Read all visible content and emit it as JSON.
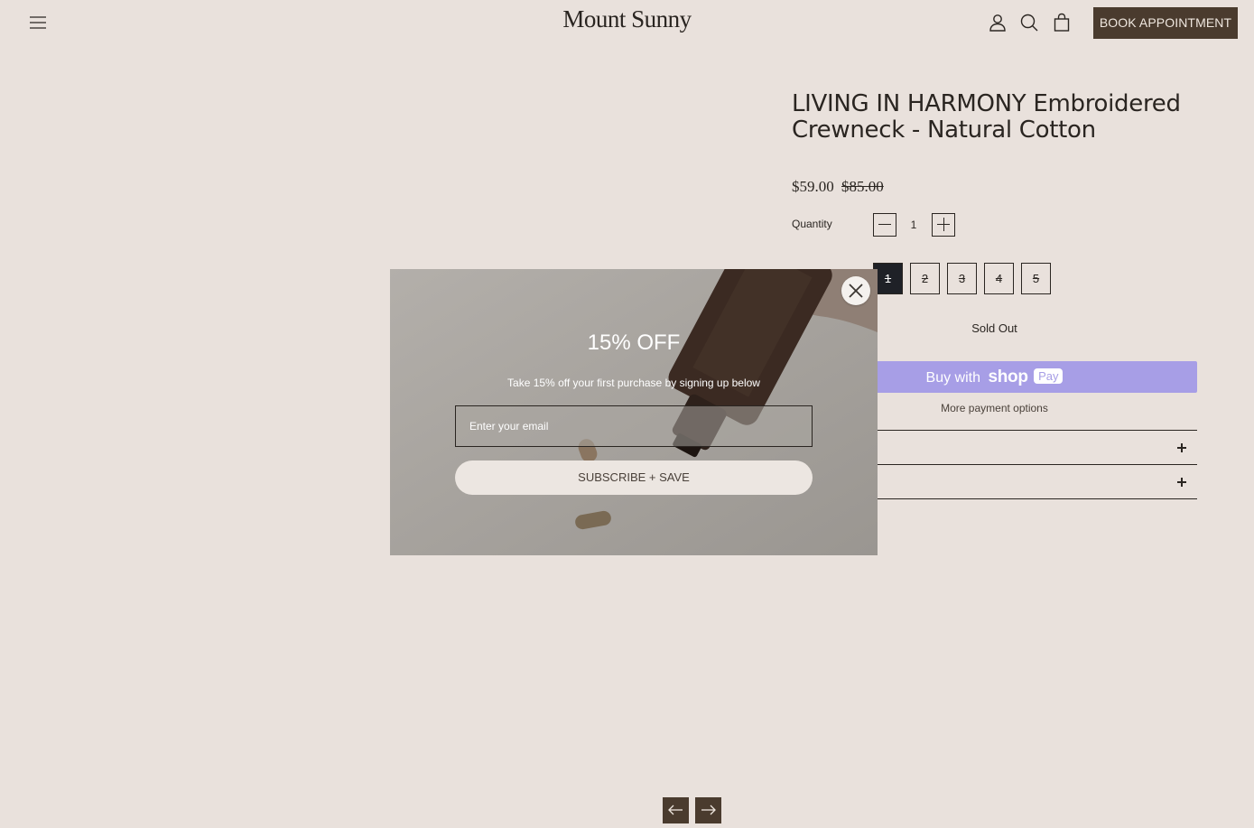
{
  "header": {
    "logo": "Mount Sunny",
    "book_label": "BOOK APPOINTMENT"
  },
  "product": {
    "title": "LIVING IN HARMONY Embroidered Crewneck - Natural Cotton",
    "price": "$59.00",
    "compare_price": "$85.00",
    "quantity_label": "Quantity",
    "quantity_value": "1",
    "variants": [
      "1",
      "2",
      "3",
      "4",
      "5"
    ],
    "selected_variant": "1",
    "sold_out_label": "Sold Out",
    "shop_pay": {
      "prefix": "Buy with",
      "brand": "shop",
      "pill": "Pay"
    },
    "more_payment_label": "More payment options"
  },
  "popup": {
    "heading": "15% OFF",
    "subtext": "Take 15% off your first purchase by signing up below",
    "email_placeholder": "Enter your email",
    "submit_label": "SUBSCRIBE + SAVE"
  },
  "colors": {
    "background": "#e9e1dc",
    "accent_brown": "#4a3b2e",
    "shop_pay": "#a79ee6",
    "variant_selected": "#1f2127"
  },
  "icons": {
    "menu": "hamburger-menu-icon",
    "account": "user-icon",
    "search": "search-icon",
    "cart": "shopping-bag-icon",
    "close": "close-icon",
    "prev": "arrow-left-icon",
    "next": "arrow-right-icon"
  }
}
